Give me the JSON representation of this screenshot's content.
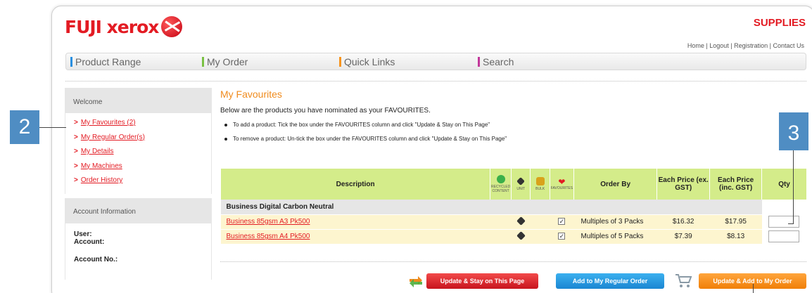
{
  "brand": {
    "logo_text": "FUJI xerox",
    "supplies": "SUPPLIES",
    "accent": "#e31b23"
  },
  "toplinks": {
    "home": "Home",
    "logout": "Logout",
    "registration": "Registration",
    "contact": "Contact Us",
    "sep": " | "
  },
  "nav": [
    {
      "label": "Product Range",
      "color": "#2a8fe0"
    },
    {
      "label": "My Order",
      "color": "#7ac143"
    },
    {
      "label": "Quick Links",
      "color": "#f7941d"
    },
    {
      "label": "Search",
      "color": "#c2379a"
    }
  ],
  "sidebar": {
    "welcome": "Welcome",
    "items": [
      {
        "arrow": ">",
        "label": "My Favourites (2)"
      },
      {
        "arrow": ">",
        "label": "My Regular Order(s)"
      },
      {
        "arrow": ">",
        "label": "My Details"
      },
      {
        "arrow": ">",
        "label": "My Machines"
      },
      {
        "arrow": ">",
        "label": "Order History"
      }
    ],
    "account_head": "Account Information",
    "user_label": "User:",
    "account_label": "Account:",
    "account_no_label": "Account No.:"
  },
  "main": {
    "title": "My Favourites",
    "intro": "Below are the products you have nominated as your FAVOURITES.",
    "bullets": [
      "To add a product: Tick the box under the FAVOURITES column and click \"Update & Stay on This Page\"",
      "To remove a product: Un-tick the box under the FAVOURITES column and click \"Update & Stay on This Page\""
    ]
  },
  "table": {
    "headers": {
      "description": "Description",
      "recycled": "RECYCLED CONTENT",
      "unit": "UNIT",
      "bulk": "BULK",
      "favourites": "FAVOURITES",
      "order_by": "Order By",
      "price_ex": "Each Price (ex. GST)",
      "price_inc": "Each Price (inc. GST)",
      "qty": "Qty"
    },
    "group": "Business Digital Carbon Neutral",
    "rows": [
      {
        "description": "Business 85gsm A3 Pk500",
        "favourite": "✓",
        "order_by": "Multiples of 3 Packs",
        "price_ex": "$16.32",
        "price_inc": "$17.95",
        "qty": ""
      },
      {
        "description": "Business 85gsm A4 Pk500",
        "favourite": "✓",
        "order_by": "Multiples of 5 Packs",
        "price_ex": "$7.39",
        "price_inc": "$8.13",
        "qty": ""
      }
    ]
  },
  "buttons": {
    "update_stay": "Update & Stay on This Page",
    "add_regular": "Add to My Regular Order",
    "update_add": "Update & Add to My Order"
  },
  "callouts": {
    "left": "2",
    "right": "3"
  },
  "colors": {
    "callout": "#4f8dc3",
    "header_green": "#d4ec8a",
    "row_yellow": "#fdf5cf",
    "title_orange": "#f08b1d"
  }
}
